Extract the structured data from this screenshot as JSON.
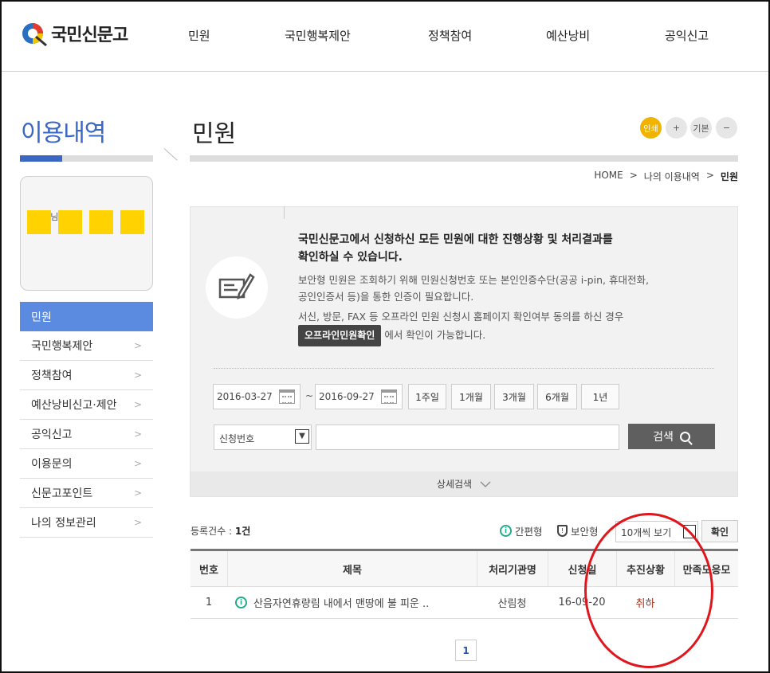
{
  "logo": {
    "text": "국민신문고"
  },
  "gnb": [
    "민원",
    "국민행복제안",
    "정책참여",
    "예산낭비",
    "공익신고"
  ],
  "sidebar": {
    "title": "이용내역",
    "profile_text": "민  호  님",
    "items": [
      {
        "label": "민원",
        "active": true
      },
      {
        "label": "국민행복제안"
      },
      {
        "label": "정책참여"
      },
      {
        "label": "예산낭비신고·제안"
      },
      {
        "label": "공익신고"
      },
      {
        "label": "이용문의"
      },
      {
        "label": "신문고포인트"
      },
      {
        "label": "나의 정보관리"
      }
    ],
    "arrow": ">"
  },
  "content": {
    "title": "민원",
    "font_controls": {
      "print": "인쇄",
      "plus": "+",
      "default": "기본",
      "minus": "−"
    },
    "breadcrumb": [
      "HOME",
      ">",
      "나의 이용내역",
      ">",
      "민원"
    ]
  },
  "info": {
    "title_line1": "국민신문고에서 신청하신 모든 민원에 대한 진행상황 및 처리결과를",
    "title_line2": "확인하실 수 있습니다.",
    "text1_line1": "보안형 민원은 조회하기 위해 민원신청번호 또는 본인인증수단(공공 i-pin, 휴대전화,",
    "text1_line2": "공인인증서 등)을 통한 인증이 필요합니다.",
    "text2_line1": "서신, 방문, FAX 등 오프라인 민원 신청시 홈페이지 확인여부 동의를 하신 경우",
    "offline_button": "오프라인민원확인",
    "text2_line2": "에서 확인이 가능합니다."
  },
  "search": {
    "start_date": "2016-03-27",
    "end_date": "2016-09-27",
    "tilde": "~",
    "periods": [
      "1주일",
      "1개월",
      "3개월",
      "6개월",
      "1년"
    ],
    "field_select": "신청번호",
    "keyword": "",
    "search_button": "검색",
    "advanced": "상세검색",
    "advanced_icon": "chevron-down-icon"
  },
  "list": {
    "count_label": "등록건수 : ",
    "count_value": "1건",
    "view_simple": "간편형",
    "view_secure": "보안형",
    "page_size": "10개씩 보기",
    "confirm_button": "확인",
    "columns": [
      "번호",
      "제목",
      "처리기관명",
      "신청일",
      "추진상황",
      "만족도응모"
    ],
    "rows": [
      {
        "no": "1",
        "subject": "산음자연휴량림 내에서 맨땅에 불 피운 ..",
        "agency": "산림청",
        "date": "16-09-20",
        "status": "취하",
        "satisfaction": ""
      }
    ]
  },
  "pagination": {
    "current": "1"
  },
  "colors": {
    "accent": "#3a66c4",
    "active_menu": "#5b8be0",
    "print_button": "#f0b400",
    "annotation": "#e0161d",
    "status_text": "#a5321a"
  }
}
